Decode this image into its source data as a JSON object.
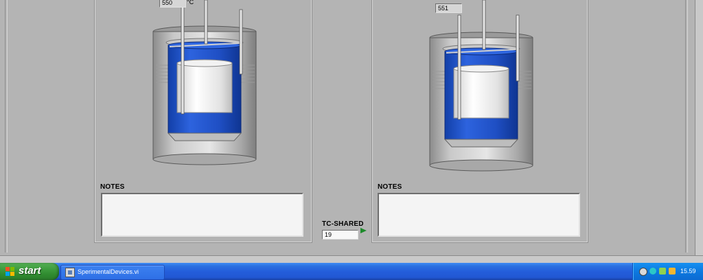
{
  "devices": [
    {
      "id": "left",
      "temperature_value": "550",
      "temperature_unit": "°C",
      "notes_label": "NOTES",
      "notes_text": ""
    },
    {
      "id": "right",
      "temperature_value": "551",
      "notes_label": "NOTES",
      "notes_text": ""
    }
  ],
  "shared": {
    "label": "TC-SHARED",
    "value": "19"
  },
  "taskbar": {
    "start_label": "start",
    "task_label": "SperimentalDevices.vi",
    "clock": "15.59"
  },
  "colors": {
    "crucible_blue": "#1f4fc4",
    "panel_gray": "#b4b4b4",
    "taskbar_blue": "#245edb",
    "start_green": "#3c9a3c",
    "indicator_green": "#1d8a2b"
  },
  "icons": {
    "tray": [
      "network-icon",
      "refresh-icon",
      "volume-icon",
      "security-icon"
    ]
  }
}
